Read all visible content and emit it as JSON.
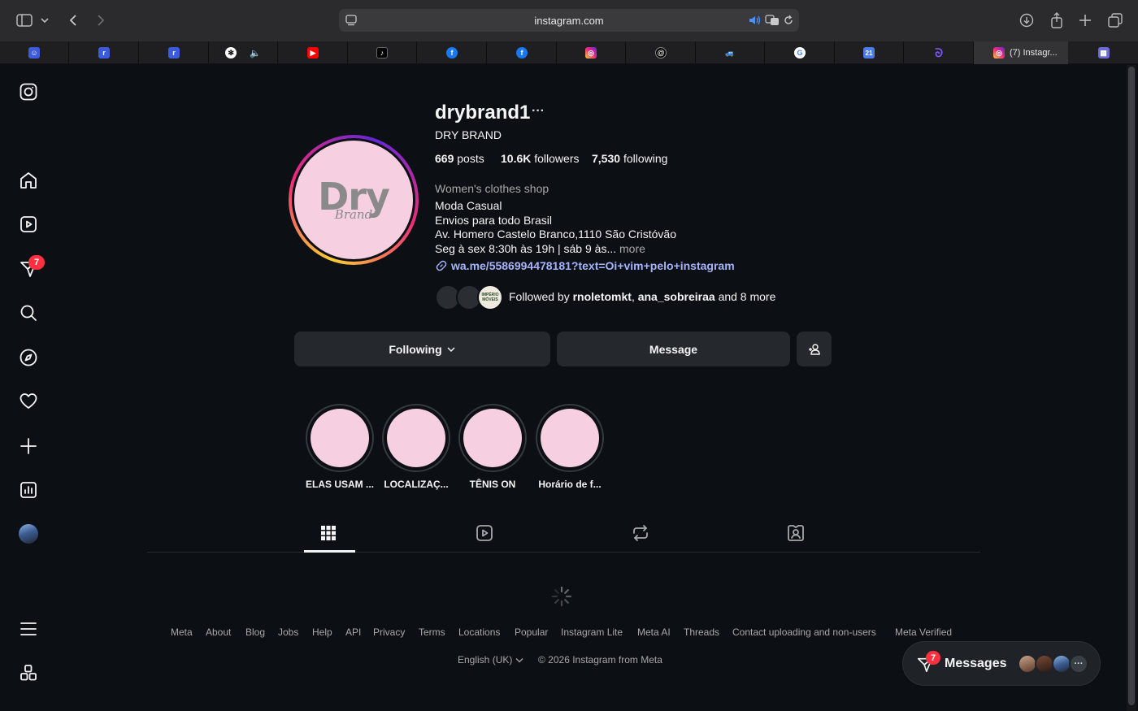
{
  "browser": {
    "url": "instagram.com",
    "active_tab_title": "(7) Instagr..."
  },
  "sidebar": {
    "notification_badge": "7",
    "items": [
      "instagram-logo",
      "home",
      "reels",
      "messages",
      "search",
      "explore",
      "notifications",
      "create",
      "dashboard",
      "profile",
      "more",
      "also-from-meta"
    ]
  },
  "profile": {
    "username": "drybrand1",
    "full_name": "DRY BRAND",
    "avatar_text": "Dry",
    "avatar_subtext": "Brand",
    "posts_count": "669",
    "posts_label": "posts",
    "followers_count": "10.6K",
    "followers_label": "followers",
    "following_count": "7,530",
    "following_label": "following",
    "category": "Women's clothes shop",
    "bio_lines": [
      "Moda Casual",
      "Envios para todo Brasil",
      "Av. Homero Castelo Branco,1110 São Cristóvão"
    ],
    "bio_truncated": "Seg à sex 8:30h às 19h | sáb 9 às...",
    "more_label": "more",
    "link": "wa.me/5586994478181?text=Oi+vim+pelo+instagram",
    "followed_by_prefix": "Followed by",
    "followed_by_user1": "rnoletomkt",
    "followed_by_sep": ",",
    "followed_by_user2": "ana_sobreiraa",
    "followed_by_suffix": "and 8 more",
    "follower_avatar_text": "IMPÉRIO MÓVEIS"
  },
  "actions": {
    "following_label": "Following",
    "message_label": "Message"
  },
  "highlights": [
    {
      "label": "ELAS USAM ..."
    },
    {
      "label": "LOCALIZAÇ..."
    },
    {
      "label": "TÊNIS ON"
    },
    {
      "label": "Horário de f..."
    }
  ],
  "footer": {
    "links": [
      "Meta",
      "About",
      "Blog",
      "Jobs",
      "Help",
      "API",
      "Privacy",
      "Terms",
      "Locations",
      "Popular",
      "Instagram Lite",
      "Meta AI",
      "Threads",
      "Contact uploading and non-users",
      "Meta Verified"
    ],
    "language": "English (UK)",
    "copyright": "© 2026 Instagram from Meta"
  },
  "messages_widget": {
    "label": "Messages",
    "badge": "7"
  },
  "colors": {
    "background": "#0c0f14",
    "button": "#25292e",
    "link": "#a5b4fc",
    "badge": "#ff3040",
    "avatar_pink": "#f6cfe0"
  }
}
